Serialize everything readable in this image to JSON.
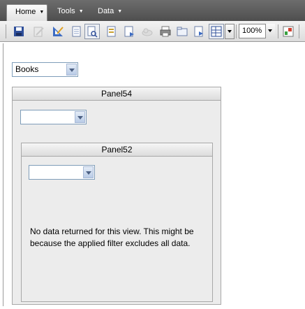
{
  "menu": {
    "tabs": [
      {
        "label": "Home"
      },
      {
        "label": "Tools"
      },
      {
        "label": "Data"
      }
    ]
  },
  "toolbar": {
    "zoom": "100%",
    "icons": [
      "save-icon",
      "edit-icon",
      "pencil-ruler-icon",
      "page-icon",
      "page-search-icon",
      "page-text-icon",
      "page-next-icon",
      "cloud-icon",
      "printer-icon",
      "folder-icon",
      "page-export-icon",
      "grid-icon",
      "zoom-dropdown",
      "chart-icon"
    ]
  },
  "filter": {
    "selected": "Books"
  },
  "outer_panel": {
    "title": "Panel54",
    "select_value": ""
  },
  "inner_panel": {
    "title": "Panel52",
    "select_value": "",
    "message_line1": "No data returned for this view. This might be",
    "message_line2": "because the applied filter excludes all data."
  }
}
